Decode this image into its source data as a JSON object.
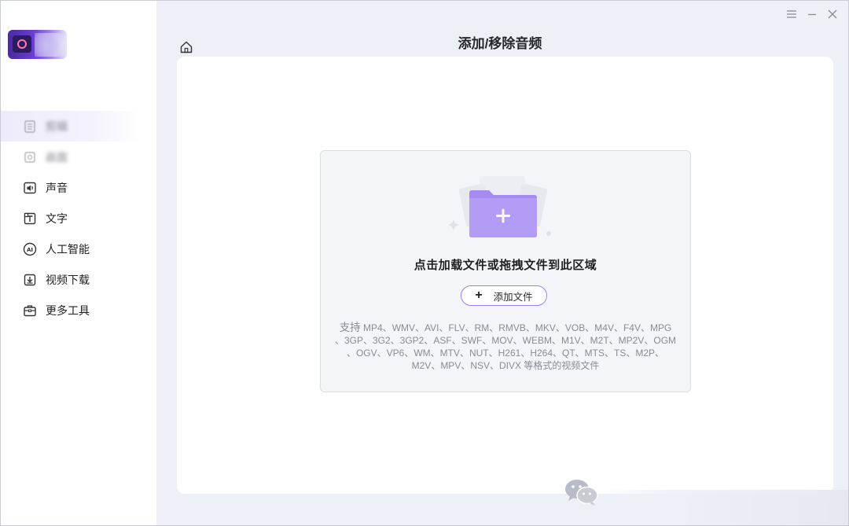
{
  "window": {
    "title": "添加/移除音频"
  },
  "sidebar": {
    "items": [
      {
        "label": "剪辑",
        "icon": "trim-icon",
        "blurred": true,
        "active": true
      },
      {
        "label": "画面",
        "icon": "frame-icon",
        "blurred": true
      },
      {
        "label": "声音",
        "icon": "sound-icon"
      },
      {
        "label": "文字",
        "icon": "text-icon"
      },
      {
        "label": "人工智能",
        "icon": "ai-icon"
      },
      {
        "label": "视频下载",
        "icon": "download-icon"
      },
      {
        "label": "更多工具",
        "icon": "toolbox-icon"
      }
    ]
  },
  "dropzone": {
    "prompt": "点击加载文件或拖拽文件到此区域",
    "add_button_label": "添加文件",
    "formats_line1_prefix": "支持",
    "formats_line1": " MP4、WMV、AVI、FLV、RM、RMVB、MKV、VOB、M4V、F4V、MPG",
    "formats_line2": "、3GP、3G2、3GP2、ASF、SWF、MOV、WEBM、M1V、M2T、MP2V、OGM",
    "formats_line3": "、OGV、VP6、WM、MTV、NUT、H261、H264、QT、MTS、TS、M2P、",
    "formats_line4": "M2V、MPV、NSV、DIVX 等格式的视频文件"
  },
  "colors": {
    "accent": "#9c7ef0",
    "folder": "#a58af2",
    "background": "#eef0f7"
  }
}
